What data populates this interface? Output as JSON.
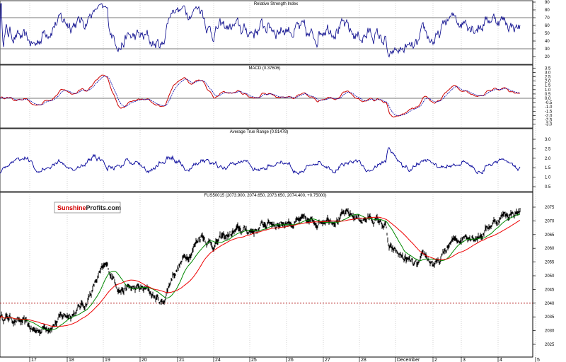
{
  "chart_data": [
    {
      "type": "line",
      "title": "Relative Strength Index",
      "yticks": [
        20,
        30,
        40,
        50,
        60,
        70,
        80,
        90
      ],
      "ylim": [
        13,
        93
      ],
      "reference_lines": [
        30,
        70
      ]
    },
    {
      "type": "line",
      "title": "MACD (0.37606)",
      "yticks": [
        "3.5",
        "3.0",
        "2.5",
        "2.0",
        "1.5",
        "1.0",
        "0.5",
        "0.0",
        "-0.5",
        "-1.0",
        "-1.5",
        "-2.0",
        "-2.5",
        "-3.0"
      ],
      "ylim": [
        -3.3,
        4.0
      ],
      "reference_lines": [
        0
      ],
      "series": [
        {
          "name": "MACD",
          "color": "#cc0000"
        },
        {
          "name": "Signal",
          "color": "#0000aa"
        }
      ]
    },
    {
      "type": "line",
      "title": "Average True Range (0.91478)",
      "yticks": [
        "3.0",
        "2.5",
        "2.0",
        "1.5",
        "1.0",
        "0.5"
      ],
      "ylim": [
        0.3,
        3.5
      ]
    },
    {
      "type": "line",
      "title": "FUS50015 (2073.900, 2074.650, 2073.650, 2074.400, +0.75000)",
      "yticks": [
        2025,
        2030,
        2035,
        2040,
        2045,
        2050,
        2055,
        2060,
        2065,
        2070,
        2075
      ],
      "ylim": [
        2021,
        2080
      ],
      "reference_lines": [
        2040
      ],
      "x_labels": [
        "17",
        "18",
        "19",
        "20",
        "21",
        "24",
        "25",
        "26",
        "27",
        "28",
        "December",
        "2",
        "3",
        "4",
        "5"
      ],
      "price_anchors": [
        [
          0,
          2035.3
        ],
        [
          20,
          2034.5
        ],
        [
          50,
          2029.4
        ],
        [
          70,
          2032.5
        ],
        [
          97,
          2036
        ],
        [
          120,
          2039.7
        ],
        [
          140,
          2050
        ],
        [
          150,
          2052.6
        ],
        [
          170,
          2046
        ],
        [
          190,
          2045
        ],
        [
          210,
          2044.3
        ],
        [
          230,
          2039.7
        ],
        [
          245,
          2051.3
        ],
        [
          265,
          2057.7
        ],
        [
          285,
          2065.5
        ],
        [
          300,
          2061.6
        ],
        [
          330,
          2065.5
        ],
        [
          360,
          2066.8
        ],
        [
          380,
          2069.3
        ],
        [
          410,
          2070
        ],
        [
          440,
          2068.6
        ],
        [
          460,
          2071.9
        ],
        [
          480,
          2071.9
        ],
        [
          510,
          2071
        ],
        [
          530,
          2070.6
        ],
        [
          545,
          2068
        ],
        [
          550,
          2059
        ],
        [
          570,
          2056.4
        ],
        [
          590,
          2052.6
        ],
        [
          600,
          2055.7
        ],
        [
          620,
          2053.9
        ],
        [
          635,
          2060.9
        ],
        [
          660,
          2065.5
        ],
        [
          680,
          2065.5
        ],
        [
          695,
          2069.3
        ],
        [
          710,
          2071.9
        ],
        [
          735,
          2073.7
        ]
      ],
      "series": [
        {
          "name": "Price",
          "color": "#000000"
        },
        {
          "name": "Fast MA",
          "color": "#008800"
        },
        {
          "name": "Slow MA",
          "color": "#ee0000"
        }
      ]
    }
  ],
  "logo": {
    "part1": "Sunshine",
    "part2": "Profits.com"
  }
}
